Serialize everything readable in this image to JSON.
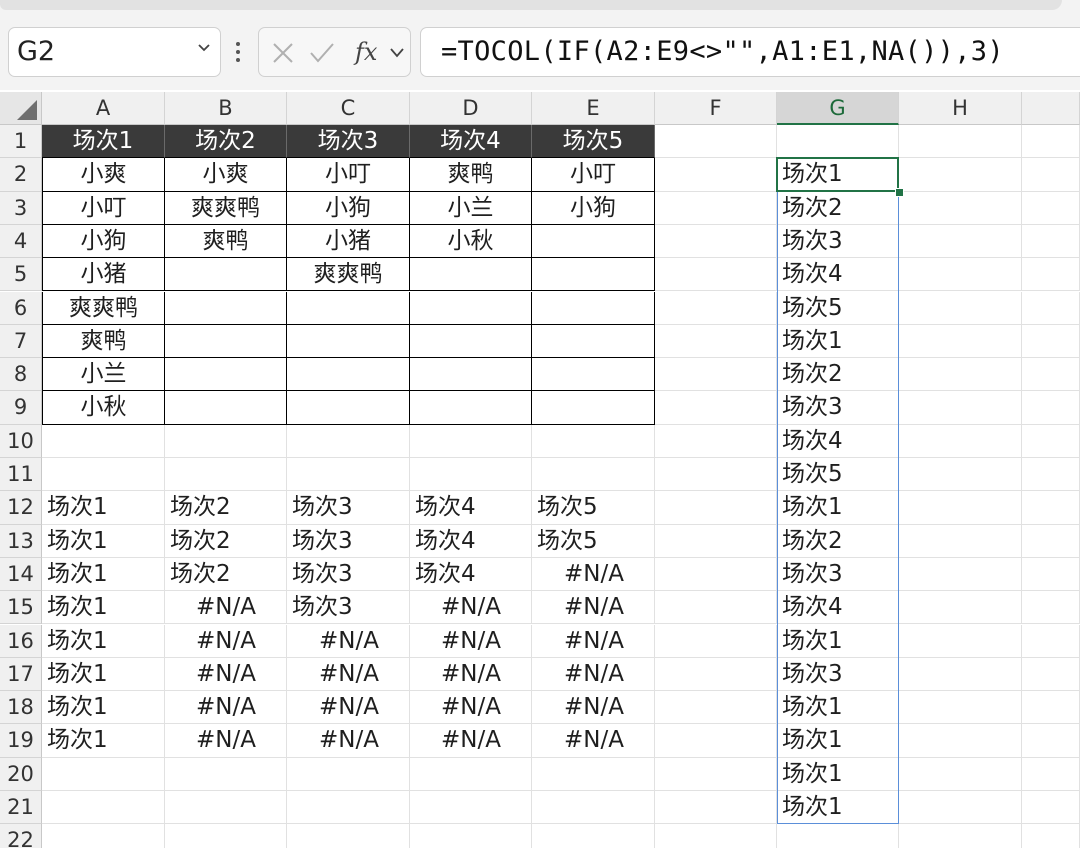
{
  "namebox": {
    "value": "G2"
  },
  "formula_bar": {
    "formula": "=TOCOL(IF(A2:E9<>\"\",A1:E1,NA()),3)"
  },
  "columns": [
    "A",
    "B",
    "C",
    "D",
    "E",
    "F",
    "G",
    "H"
  ],
  "rows": [
    "1",
    "2",
    "3",
    "4",
    "5",
    "6",
    "7",
    "8",
    "9",
    "10",
    "11",
    "12",
    "13",
    "14",
    "15",
    "16",
    "17",
    "18",
    "19",
    "20",
    "21",
    "22"
  ],
  "selected_column": "G",
  "table": {
    "headers": [
      "场次1",
      "场次2",
      "场次3",
      "场次4",
      "场次5"
    ],
    "rows": [
      [
        "小爽",
        "小爽",
        "小叮",
        "爽鸭",
        "小叮"
      ],
      [
        "小叮",
        "爽爽鸭",
        "小狗",
        "小兰",
        "小狗"
      ],
      [
        "小狗",
        "爽鸭",
        "小猪",
        "小秋",
        ""
      ],
      [
        "小猪",
        "",
        "爽爽鸭",
        "",
        ""
      ],
      [
        "爽爽鸭",
        "",
        "",
        "",
        ""
      ],
      [
        "爽鸭",
        "",
        "",
        "",
        ""
      ],
      [
        "小兰",
        "",
        "",
        "",
        ""
      ],
      [
        "小秋",
        "",
        "",
        "",
        ""
      ]
    ]
  },
  "result_matrix": [
    [
      "场次1",
      "场次2",
      "场次3",
      "场次4",
      "场次5"
    ],
    [
      "场次1",
      "场次2",
      "场次3",
      "场次4",
      "场次5"
    ],
    [
      "场次1",
      "场次2",
      "场次3",
      "场次4",
      "#N/A"
    ],
    [
      "场次1",
      "#N/A",
      "场次3",
      "#N/A",
      "#N/A"
    ],
    [
      "场次1",
      "#N/A",
      "#N/A",
      "#N/A",
      "#N/A"
    ],
    [
      "场次1",
      "#N/A",
      "#N/A",
      "#N/A",
      "#N/A"
    ],
    [
      "场次1",
      "#N/A",
      "#N/A",
      "#N/A",
      "#N/A"
    ],
    [
      "场次1",
      "#N/A",
      "#N/A",
      "#N/A",
      "#N/A"
    ]
  ],
  "column_g": [
    "场次1",
    "场次2",
    "场次3",
    "场次4",
    "场次5",
    "场次1",
    "场次2",
    "场次3",
    "场次4",
    "场次5",
    "场次1",
    "场次2",
    "场次3",
    "场次4",
    "场次1",
    "场次3",
    "场次1",
    "场次1",
    "场次1",
    "场次1"
  ],
  "colors": {
    "table_header_bg": "#3a3a3a",
    "active_border": "#217346",
    "selection_border": "#5b8fd9"
  }
}
